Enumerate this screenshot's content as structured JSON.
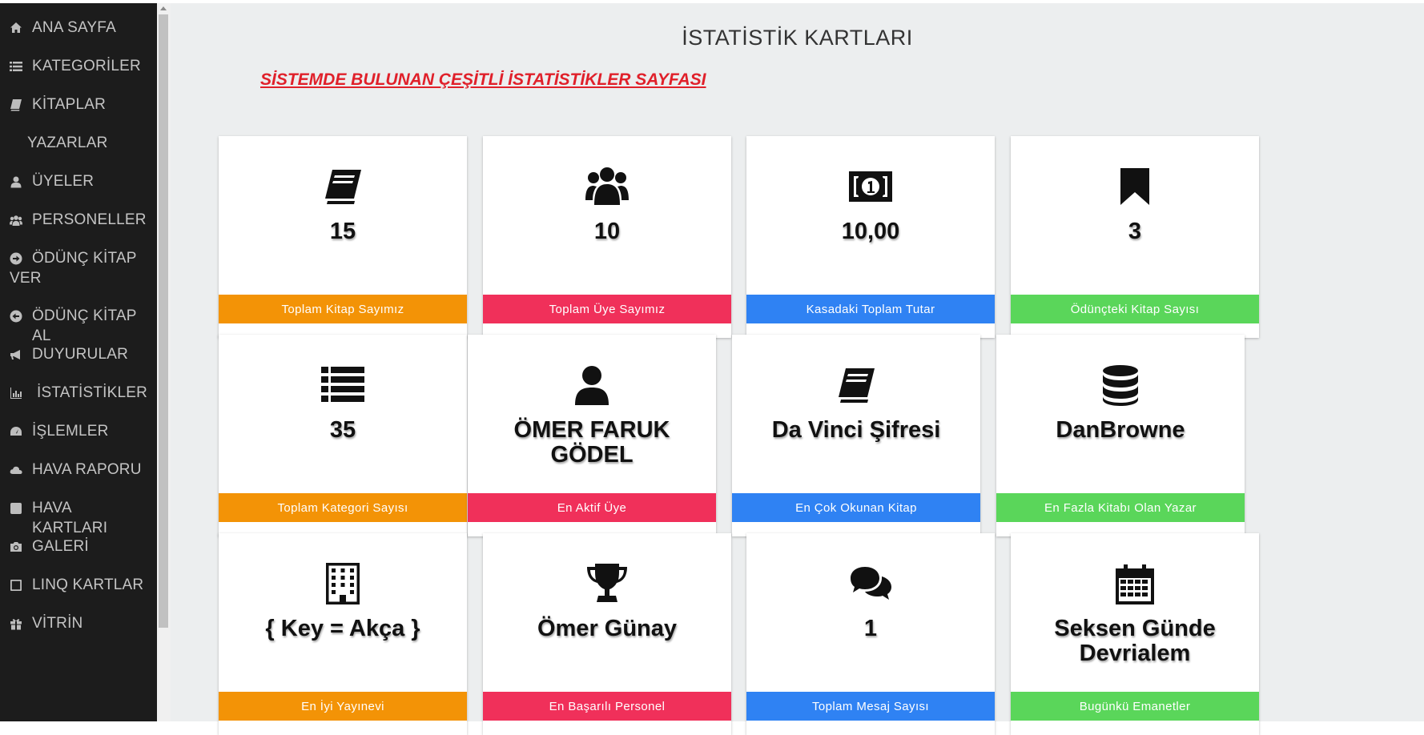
{
  "sidebar": {
    "items": [
      {
        "label": "ANA SAYFA",
        "icon": "home-icon"
      },
      {
        "label": "KATEGORİLER",
        "icon": "list-icon"
      },
      {
        "label": "KİTAPLAR",
        "icon": "book-icon"
      },
      {
        "label": "YAZARLAR",
        "icon": ""
      },
      {
        "label": "ÜYELER",
        "icon": "user-icon"
      },
      {
        "label": "PERSONELLER",
        "icon": "users-icon"
      },
      {
        "label": "ÖDÜNÇ KİTAP VER",
        "icon": "arrow-circle-right-icon"
      },
      {
        "label": "ÖDÜNÇ KİTAP AL",
        "icon": "arrow-circle-left-icon"
      },
      {
        "label": "DUYURULAR",
        "icon": "bullhorn-icon"
      },
      {
        "label": "İSTATİSTİKLER",
        "icon": "bar-chart-icon"
      },
      {
        "label": "İŞLEMLER",
        "icon": "dashboard-icon"
      },
      {
        "label": "HAVA RAPORU",
        "icon": "cloud-icon"
      },
      {
        "label": "HAVA KARTLARI",
        "icon": "square-icon"
      },
      {
        "label": "GALERİ",
        "icon": "camera-icon"
      },
      {
        "label": "LINQ KARTLAR",
        "icon": "square-outline-icon"
      },
      {
        "label": "VİTRİN",
        "icon": "gift-icon"
      }
    ]
  },
  "main": {
    "title": "İSTATİSTİK KARTLARI",
    "subtitle": "SİSTEMDE BULUNAN ÇEŞİTLİ İSTATİSTİKLER SAYFASI"
  },
  "cards": [
    {
      "value": "15",
      "label": "Toplam Kitap Sayımız",
      "icon": "book-icon",
      "color": "#f39306"
    },
    {
      "value": "10",
      "label": "Toplam Üye Sayımız",
      "icon": "users-icon",
      "color": "#f0305a"
    },
    {
      "value": "10,00",
      "label": "Kasadaki Toplam Tutar",
      "icon": "money-icon",
      "color": "#2f82f3"
    },
    {
      "value": "3",
      "label": "Ödünçteki Kitap Sayısı",
      "icon": "bookmark-icon",
      "color": "#5ad65a"
    },
    {
      "value": "35",
      "label": "Toplam Kategori Sayısı",
      "icon": "list-icon",
      "color": "#f39306"
    },
    {
      "value": "ÖMER FARUK GÖDEL",
      "label": "En Aktif Üye",
      "icon": "user-icon",
      "color": "#f0305a"
    },
    {
      "value": "Da Vinci Şifresi",
      "label": "En Çok Okunan Kitap",
      "icon": "book-icon",
      "color": "#2f82f3"
    },
    {
      "value": "DanBrowne",
      "label": "En Fazla Kitabı Olan Yazar",
      "icon": "database-icon",
      "color": "#5ad65a"
    },
    {
      "value": "{ Key = Akça }",
      "label": "En İyi Yayınevi",
      "icon": "building-icon",
      "color": "#f39306"
    },
    {
      "value": "Ömer Günay",
      "label": "En Başarılı Personel",
      "icon": "trophy-icon",
      "color": "#f0305a"
    },
    {
      "value": "1",
      "label": "Toplam Mesaj Sayısı",
      "icon": "comments-icon",
      "color": "#2f82f3"
    },
    {
      "value": "Seksen Günde Devrialem",
      "label": "Bugünkü Emanetler",
      "icon": "calendar-icon",
      "color": "#5ad65a"
    }
  ]
}
